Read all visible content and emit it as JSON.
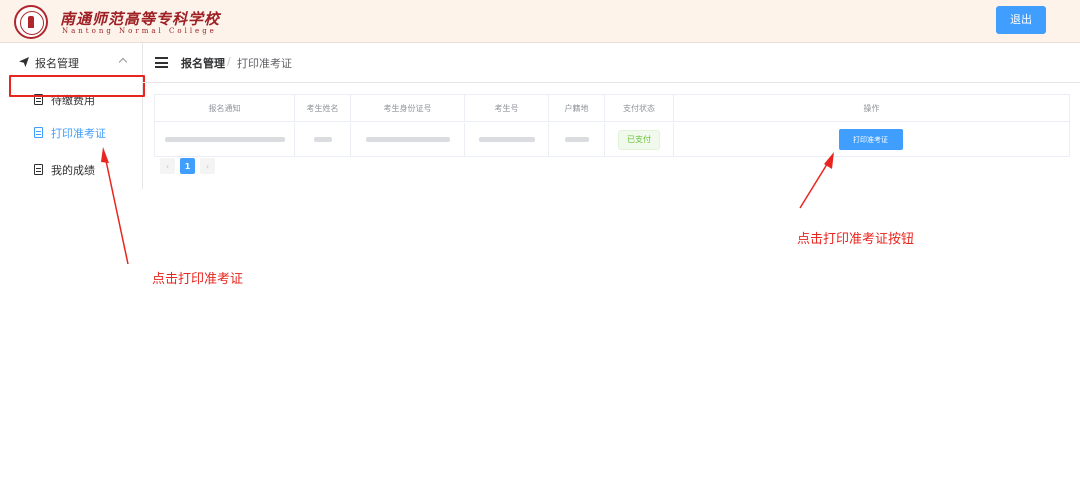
{
  "header": {
    "school_name_cn": "南通师范高等专科学校",
    "school_name_en": "Nantong Normal College",
    "logout_label": "退出"
  },
  "sidebar": {
    "group_label": "报名管理",
    "items": [
      {
        "label": "待缴费用"
      },
      {
        "label": "打印准考证"
      },
      {
        "label": "我的成绩"
      }
    ]
  },
  "breadcrumb": {
    "items": [
      "报名管理",
      "打印准考证"
    ],
    "separator": "/"
  },
  "table": {
    "columns": [
      "报名通知",
      "考生姓名",
      "考生身份证号",
      "考生号",
      "户籍地",
      "支付状态",
      "操作"
    ],
    "rows": [
      {
        "status": "已支付",
        "action_label": "打印准考证"
      }
    ]
  },
  "pagination": {
    "current_page": "1",
    "prev_symbol": "‹",
    "next_symbol": "›"
  },
  "annotations": {
    "sidebar_hint": "点击打印准考证",
    "button_hint": "点击打印准考证按钮"
  },
  "colors": {
    "primary": "#409eff",
    "annotation_red": "#e8261f",
    "brand_red": "#9e1f24",
    "success": "#67c23a",
    "header_bg": "#fdf3ea"
  },
  "icons": [
    "school-seal-logo",
    "send-icon",
    "chevron-up-icon",
    "document-icon",
    "hamburger-menu-icon"
  ]
}
